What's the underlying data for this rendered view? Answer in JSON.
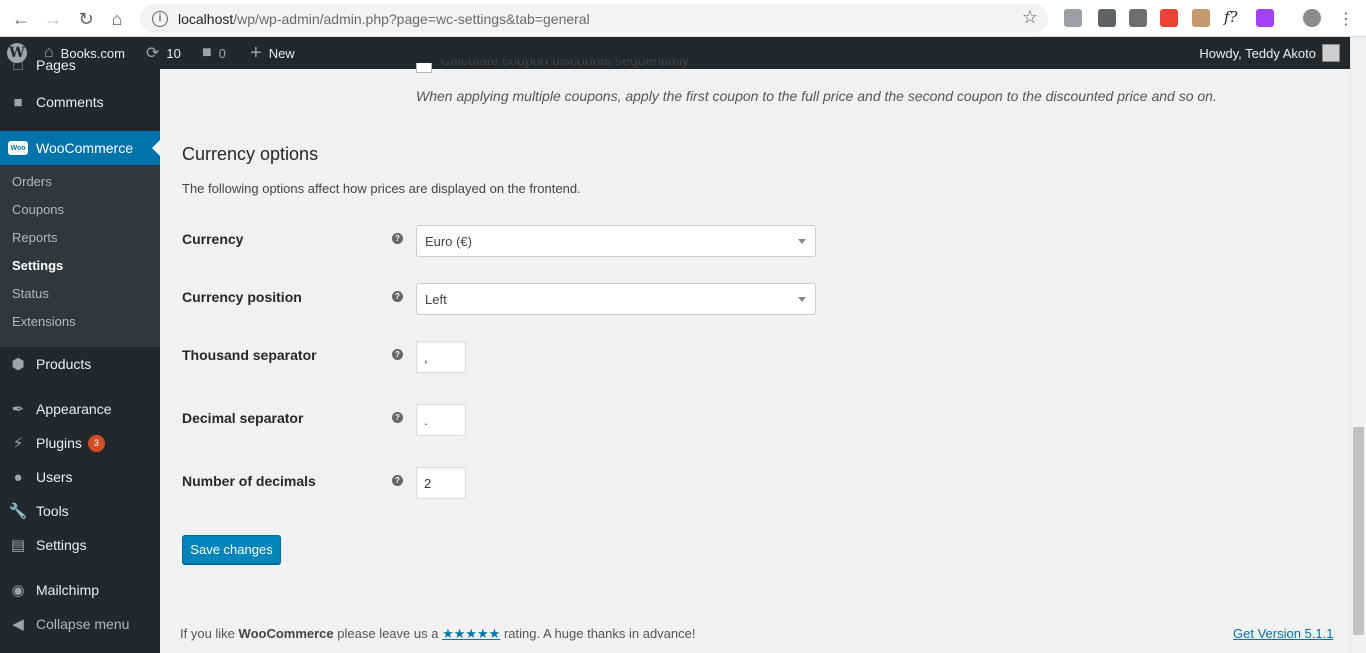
{
  "browser": {
    "url_host": "localhost",
    "url_path": "/wp/wp-admin/admin.php?page=wc-settings&tab=general",
    "ext_colors": [
      "#9aa0a6",
      "#5f6368",
      "#6f6f6f",
      "#ea4335",
      "#c59b6d",
      "#202124",
      "#a142f4"
    ]
  },
  "adminbar": {
    "site_name": "Books.com",
    "updates_count": "10",
    "comments_count": "0",
    "new_label": "New",
    "howdy": "Howdy, Teddy Akoto"
  },
  "sidebar": {
    "pages_label": "Pages",
    "comments_label": "Comments",
    "woocommerce_label": "WooCommerce",
    "woo_icon_text": "Woo",
    "submenu": [
      "Orders",
      "Coupons",
      "Reports",
      "Settings",
      "Status",
      "Extensions"
    ],
    "products_label": "Products",
    "appearance_label": "Appearance",
    "plugins_label": "Plugins",
    "plugins_badge": "3",
    "users_label": "Users",
    "tools_label": "Tools",
    "settings_label": "Settings",
    "mailchimp_label": "Mailchimp",
    "collapse_label": "Collapse menu"
  },
  "content": {
    "partial_checkbox_label": "Calculate coupon discounts sequentially",
    "coupon_description": "When applying multiple coupons, apply the first coupon to the full price and the second coupon to the discounted price and so on.",
    "section_title": "Currency options",
    "section_description": "The following options affect how prices are displayed on the frontend.",
    "currency_label": "Currency",
    "currency_value": "Euro (€)",
    "position_label": "Currency position",
    "position_value": "Left",
    "thousand_label": "Thousand separator",
    "thousand_value": ",",
    "decimal_label": "Decimal separator",
    "decimal_value": ".",
    "decimals_label": "Number of decimals",
    "decimals_value": "2",
    "help_glyph": "?",
    "save_label": "Save changes"
  },
  "footer": {
    "text_before": "If you like ",
    "brand": "WooCommerce",
    "text_middle": " please leave us a ",
    "stars": "★★★★★",
    "text_after": " rating. A huge thanks in advance!",
    "version_link": "Get Version 5.1.1"
  }
}
